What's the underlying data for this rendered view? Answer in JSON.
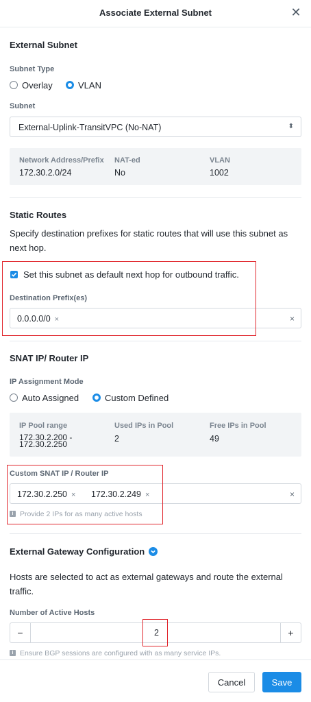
{
  "dialog": {
    "title": "Associate External Subnet",
    "close_glyph": "✕"
  },
  "external_subnet": {
    "heading": "External Subnet",
    "subnet_type_label": "Subnet Type",
    "options": [
      "Overlay",
      "VLAN"
    ],
    "selected_option": "VLAN",
    "subnet_label": "Subnet",
    "subnet_value": "External-Uplink-TransitVPC (No-NAT)",
    "subnet_arrow": "⬍",
    "info": {
      "network_label": "Network Address/Prefix",
      "network_value": "172.30.2.0/24",
      "nat_label": "NAT-ed",
      "nat_value": "No",
      "vlan_label": "VLAN",
      "vlan_value": "1002"
    }
  },
  "static_routes": {
    "heading": "Static Routes",
    "description": "Specify destination prefixes for static routes that will use this subnet as next hop.",
    "checkbox_label": "Set this subnet as default next hop for outbound traffic.",
    "checkbox_checked": true,
    "dest_label": "Destination Prefix(es)",
    "dest_tags": [
      "0.0.0.0/0"
    ],
    "tag_remove_glyph": "×",
    "clear_glyph": "×"
  },
  "snat": {
    "heading": "SNAT IP/ Router IP",
    "mode_label": "IP Assignment Mode",
    "options": [
      "Auto Assigned",
      "Custom Defined"
    ],
    "selected_option": "Custom Defined",
    "pool": {
      "range_label": "IP Pool range",
      "range_line1": "172.30.2.200 -",
      "range_line2": "172.30.2.250",
      "used_label": "Used IPs in Pool",
      "used_value": "2",
      "free_label": "Free IPs in Pool",
      "free_value": "49"
    },
    "custom_label": "Custom SNAT IP / Router IP",
    "custom_tags": [
      "172.30.2.250",
      "172.30.2.249"
    ],
    "hint": "Provide 2 IPs for as many active hosts"
  },
  "gateway": {
    "heading": "External Gateway Configuration",
    "description": "Hosts are selected to act as external gateways and route the external traffic.",
    "hosts_label": "Number of Active Hosts",
    "hosts_value": "2",
    "minus_glyph": "−",
    "plus_glyph": "+",
    "hint": "Ensure BGP sessions are configured with as many service IPs."
  },
  "footer": {
    "cancel_label": "Cancel",
    "save_label": "Save"
  },
  "colors": {
    "accent": "#1b8ce6",
    "highlight_box": "#e0242b"
  }
}
